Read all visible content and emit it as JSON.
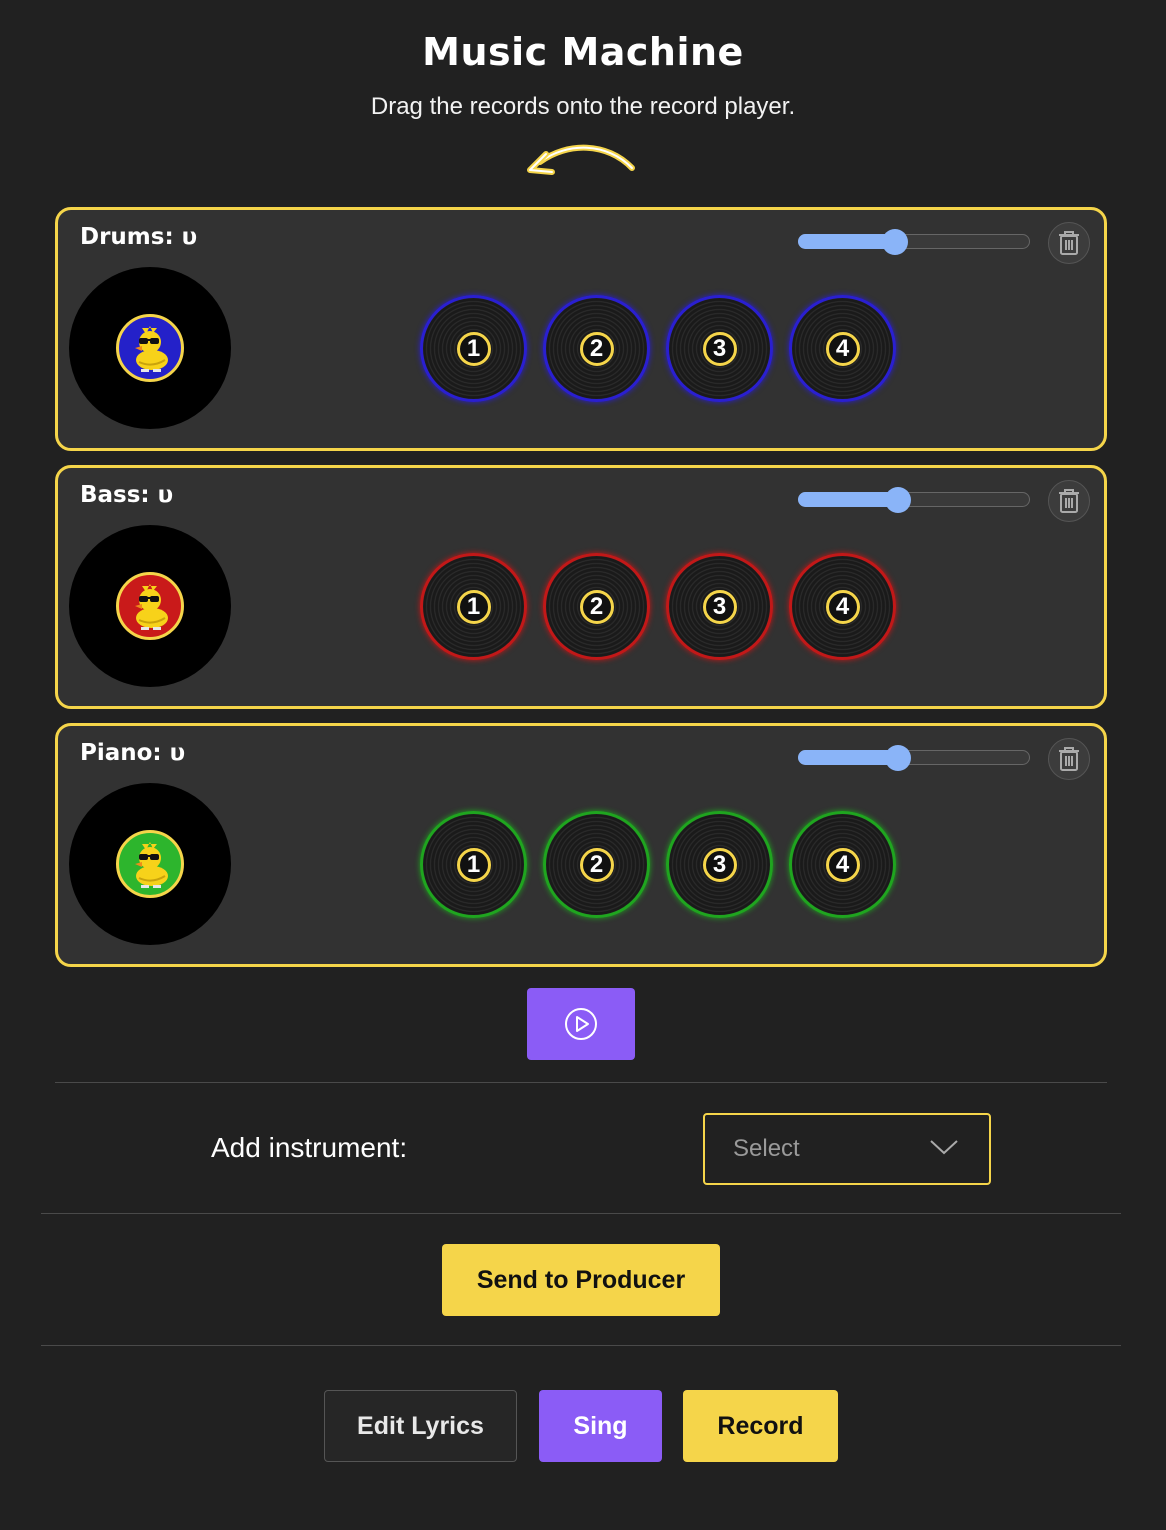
{
  "header": {
    "title": "Music Machine",
    "subtitle": "Drag the records onto the record player."
  },
  "tracks": [
    {
      "label": "Drums: υ",
      "color": "#2a1fd1",
      "badge_bg": "#2421c9",
      "volume": 0.42,
      "records": [
        "1",
        "2",
        "3",
        "4"
      ],
      "icons": {
        "trash": "trash-icon",
        "duck": "duck-sunglasses-icon"
      }
    },
    {
      "label": "Bass: υ",
      "color": "#c21818",
      "badge_bg": "#c91a1a",
      "volume": 0.43,
      "records": [
        "1",
        "2",
        "3",
        "4"
      ],
      "icons": {
        "trash": "trash-icon",
        "duck": "duck-sunglasses-icon"
      }
    },
    {
      "label": "Piano: υ",
      "color": "#1fa51f",
      "badge_bg": "#2db52d",
      "volume": 0.43,
      "records": [
        "1",
        "2",
        "3",
        "4"
      ],
      "icons": {
        "trash": "trash-icon",
        "duck": "duck-sunglasses-icon"
      }
    }
  ],
  "controls": {
    "play_icon": "play-circle-icon",
    "add_instrument_label": "Add instrument:",
    "select_value": "Select",
    "send_label": "Send to Producer",
    "edit_lyrics_label": "Edit Lyrics",
    "sing_label": "Sing",
    "record_label": "Record"
  },
  "colors": {
    "accent_yellow": "#f5d54a",
    "accent_purple": "#8b5cf6",
    "slider_blue": "#8ab4f8",
    "background": "#212121"
  }
}
